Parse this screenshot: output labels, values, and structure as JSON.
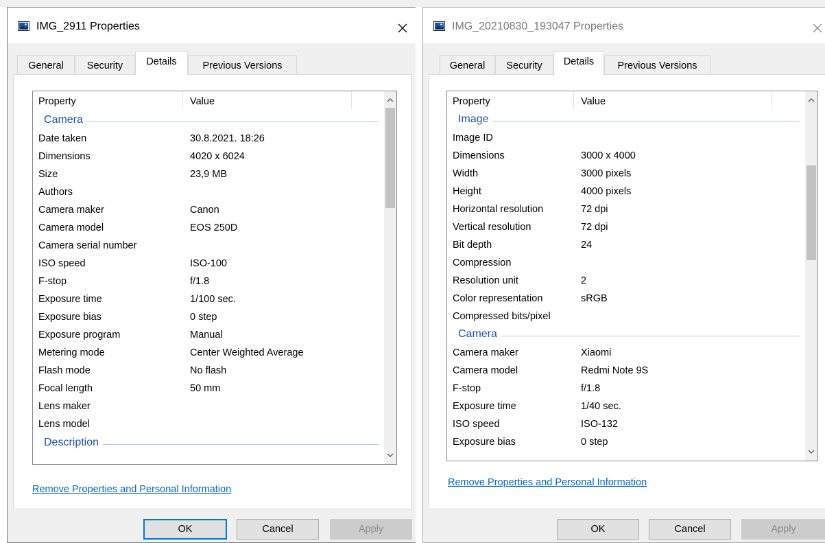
{
  "left": {
    "title": "IMG_2911 Properties",
    "close": "✕",
    "tabs": [
      "General",
      "Security",
      "Details",
      "Previous Versions"
    ],
    "selected_tab": "Details",
    "header": {
      "property": "Property",
      "value": "Value"
    },
    "group1": "Camera",
    "rows": [
      {
        "p": "Date taken",
        "v": "30.8.2021. 18:26"
      },
      {
        "p": "Dimensions",
        "v": "4020 x 6024"
      },
      {
        "p": "Size",
        "v": "23,9 MB"
      },
      {
        "p": "Authors",
        "v": ""
      },
      {
        "p": "Camera maker",
        "v": "Canon"
      },
      {
        "p": "Camera model",
        "v": "EOS 250D"
      },
      {
        "p": "Camera serial number",
        "v": ""
      },
      {
        "p": "ISO speed",
        "v": "ISO-100"
      },
      {
        "p": "F-stop",
        "v": "f/1.8"
      },
      {
        "p": "Exposure time",
        "v": "1/100 sec."
      },
      {
        "p": "Exposure bias",
        "v": "0 step"
      },
      {
        "p": "Exposure program",
        "v": "Manual"
      },
      {
        "p": "Metering mode",
        "v": "Center Weighted Average"
      },
      {
        "p": "Flash mode",
        "v": "No flash"
      },
      {
        "p": "Focal length",
        "v": "50 mm"
      },
      {
        "p": "Lens maker",
        "v": ""
      },
      {
        "p": "Lens model",
        "v": ""
      }
    ],
    "group2": "Description",
    "remove_link": "Remove Properties and Personal Information",
    "buttons": {
      "ok": "OK",
      "cancel": "Cancel",
      "apply": "Apply"
    }
  },
  "right": {
    "title": "IMG_20210830_193047 Properties",
    "close": "✕",
    "tabs": [
      "General",
      "Security",
      "Details",
      "Previous Versions"
    ],
    "selected_tab": "Details",
    "header": {
      "property": "Property",
      "value": "Value"
    },
    "group1": "Image",
    "rows1": [
      {
        "p": "Image ID",
        "v": ""
      },
      {
        "p": "Dimensions",
        "v": "3000 x 4000"
      },
      {
        "p": "Width",
        "v": "3000 pixels"
      },
      {
        "p": "Height",
        "v": "4000 pixels"
      },
      {
        "p": "Horizontal resolution",
        "v": "72 dpi"
      },
      {
        "p": "Vertical resolution",
        "v": "72 dpi"
      },
      {
        "p": "Bit depth",
        "v": "24"
      },
      {
        "p": "Compression",
        "v": ""
      },
      {
        "p": "Resolution unit",
        "v": "2"
      },
      {
        "p": "Color representation",
        "v": "sRGB"
      },
      {
        "p": "Compressed bits/pixel",
        "v": ""
      }
    ],
    "group2": "Camera",
    "rows2": [
      {
        "p": "Camera maker",
        "v": "Xiaomi"
      },
      {
        "p": "Camera model",
        "v": "Redmi Note 9S"
      },
      {
        "p": "F-stop",
        "v": "f/1.8"
      },
      {
        "p": "Exposure time",
        "v": "1/40 sec."
      },
      {
        "p": "ISO speed",
        "v": "ISO-132"
      },
      {
        "p": "Exposure bias",
        "v": "0 step"
      }
    ],
    "remove_link": "Remove Properties and Personal Information",
    "buttons": {
      "ok": "OK",
      "cancel": "Cancel",
      "apply": "Apply"
    }
  }
}
